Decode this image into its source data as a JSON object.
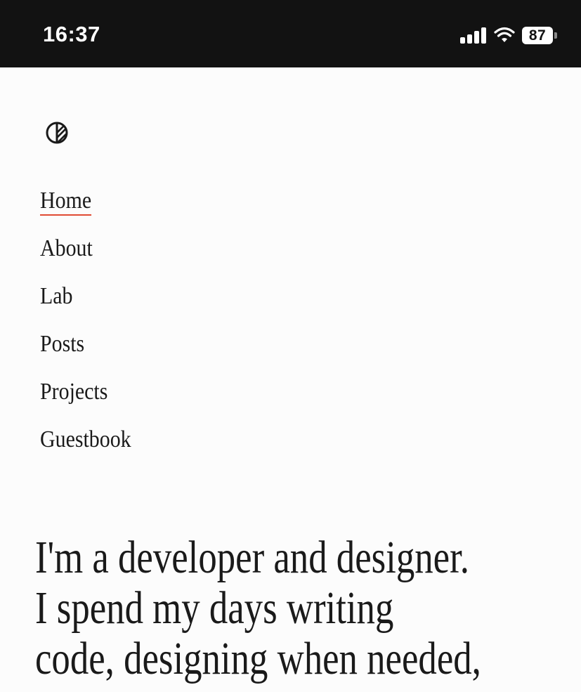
{
  "status_bar": {
    "time": "16:37",
    "battery": "87",
    "icons": [
      "signal-icon",
      "wifi-icon",
      "battery-icon"
    ]
  },
  "logo": {
    "icon": "half-striped-circle-logo"
  },
  "nav": {
    "accent_color": "#e04a33",
    "items": [
      {
        "label": "Home",
        "active": true
      },
      {
        "label": "About",
        "active": false
      },
      {
        "label": "Lab",
        "active": false
      },
      {
        "label": "Posts",
        "active": false
      },
      {
        "label": "Projects",
        "active": false
      },
      {
        "label": "Guestbook",
        "active": false
      }
    ]
  },
  "intro": {
    "lines": [
      "I'm a developer and designer.",
      "I spend my days writing",
      "code, designing when needed,"
    ]
  }
}
